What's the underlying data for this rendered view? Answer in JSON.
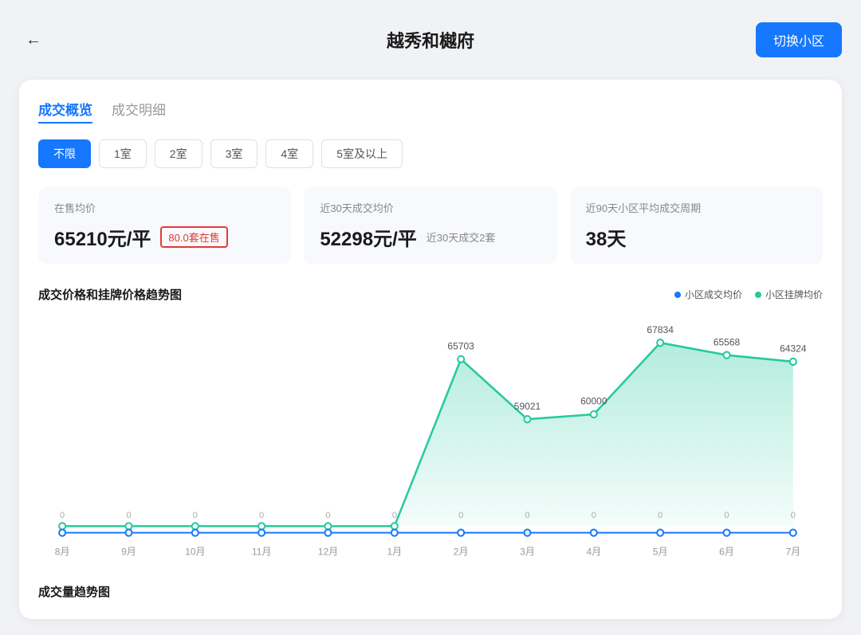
{
  "header": {
    "title": "越秀和樾府",
    "switch_btn": "切换小区",
    "back_icon": "←"
  },
  "tabs": [
    {
      "label": "成交概览",
      "active": true
    },
    {
      "label": "成交明细",
      "active": false
    }
  ],
  "filters": [
    {
      "label": "不限",
      "active": true
    },
    {
      "label": "1室",
      "active": false
    },
    {
      "label": "2室",
      "active": false
    },
    {
      "label": "3室",
      "active": false
    },
    {
      "label": "4室",
      "active": false
    },
    {
      "label": "5室及以上",
      "active": false
    }
  ],
  "stats": [
    {
      "label": "在售均价",
      "value": "65210元/平",
      "badge": "80.0套在售",
      "sub": ""
    },
    {
      "label": "近30天成交均价",
      "value": "52298元/平",
      "badge": "",
      "sub": "近30天成交2套"
    },
    {
      "label": "近90天小区平均成交周期",
      "value": "38天",
      "badge": "",
      "sub": ""
    }
  ],
  "chart": {
    "title": "成交价格和挂牌价格趋势图",
    "legend": [
      {
        "label": "小区成交均价",
        "color": "#1677ff"
      },
      {
        "label": "小区挂牌均价",
        "color": "#26c99e"
      }
    ],
    "x_labels": [
      "8月",
      "9月",
      "10月",
      "11月",
      "12月",
      "1月",
      "2月",
      "3月",
      "4月",
      "5月",
      "6月",
      "7月"
    ],
    "green_line_values": [
      0,
      0,
      0,
      0,
      0,
      0,
      65703,
      59021,
      60000,
      67834,
      65568,
      64324
    ],
    "blue_line_values": [
      0,
      0,
      0,
      0,
      0,
      0,
      0,
      0,
      0,
      0,
      0,
      0
    ],
    "data_labels": [
      "65703",
      "59021",
      "60000",
      "67834",
      "65568",
      "64324"
    ]
  },
  "bottom_section_title": "成交量趋势图"
}
